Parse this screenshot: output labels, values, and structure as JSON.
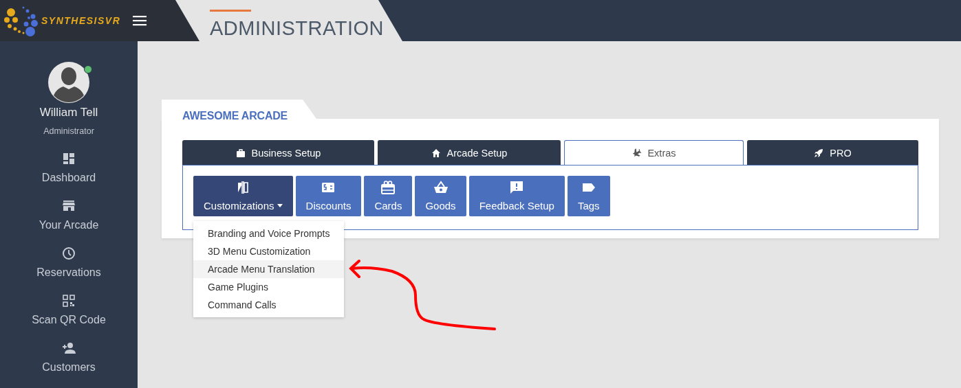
{
  "brand": {
    "name": "SYNTHESISVR"
  },
  "header": {
    "title": "ADMINISTRATION"
  },
  "user": {
    "name": "William Tell",
    "role": "Administrator",
    "online": true
  },
  "sidebar": {
    "items": [
      {
        "label": "Dashboard",
        "selected": false
      },
      {
        "label": "Your Arcade",
        "selected": false
      },
      {
        "label": "Reservations",
        "selected": false
      },
      {
        "label": "Scan QR Code",
        "selected": false
      },
      {
        "label": "Customers",
        "selected": false
      }
    ]
  },
  "card": {
    "title": "AWESOME ARCADE"
  },
  "tabs": [
    {
      "label": "Business Setup",
      "selected": false
    },
    {
      "label": "Arcade Setup",
      "selected": false
    },
    {
      "label": "Extras",
      "selected": true
    },
    {
      "label": "PRO",
      "selected": false
    }
  ],
  "subbuttons": [
    {
      "label": "Customizations",
      "selected": true,
      "kind": "dropdown"
    },
    {
      "label": "Discounts",
      "selected": false,
      "kind": "plain"
    },
    {
      "label": "Cards",
      "selected": false,
      "kind": "plain"
    },
    {
      "label": "Goods",
      "selected": false,
      "kind": "plain"
    },
    {
      "label": "Feedback Setup",
      "selected": false,
      "kind": "plain"
    },
    {
      "label": "Tags",
      "selected": false,
      "kind": "plain"
    }
  ],
  "dropdown": {
    "expanded": true,
    "items": [
      {
        "label": "Branding and Voice Prompts",
        "selected": false
      },
      {
        "label": "3D Menu Customization",
        "selected": false
      },
      {
        "label": "Arcade Menu Translation",
        "selected": true
      },
      {
        "label": "Game Plugins",
        "selected": false
      },
      {
        "label": "Command Calls",
        "selected": false
      }
    ]
  }
}
